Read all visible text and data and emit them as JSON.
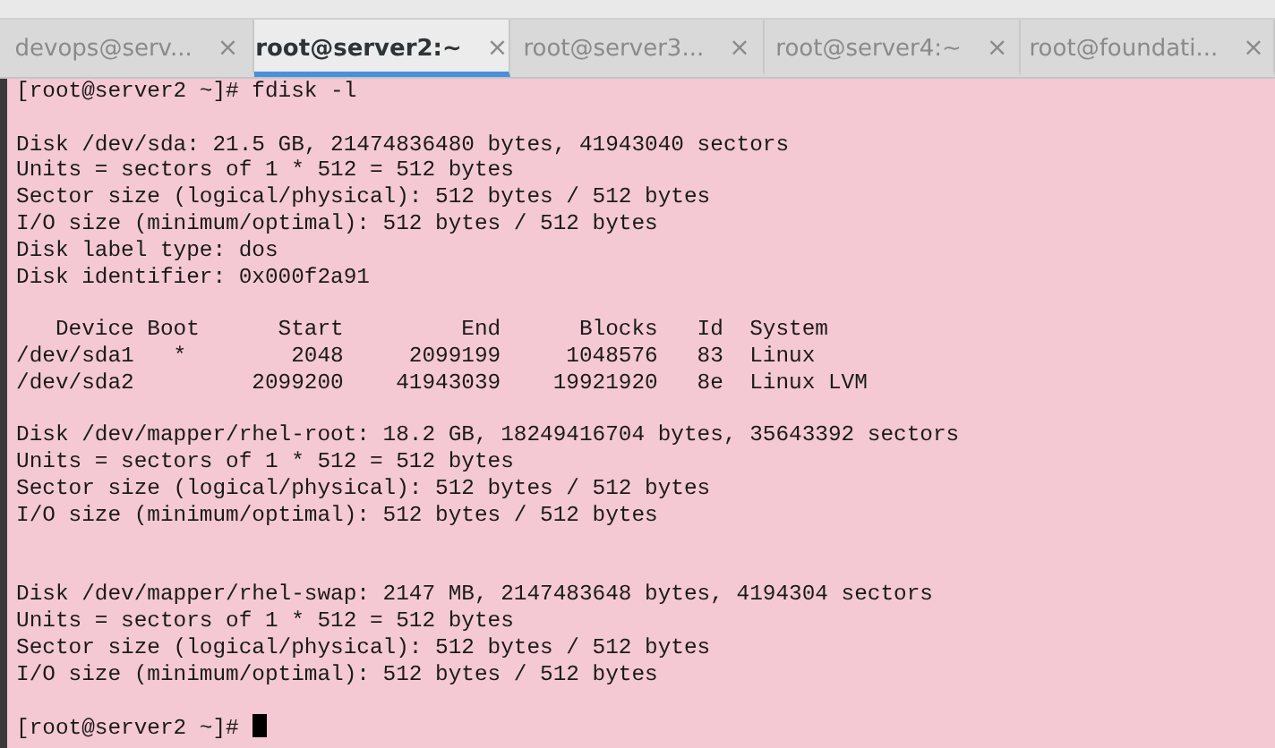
{
  "tabs": [
    {
      "label": "devops@serv...",
      "close": "×",
      "selected": false
    },
    {
      "label": "root@server2:~",
      "close": "×",
      "selected": true
    },
    {
      "label": "root@server3...",
      "close": "×",
      "selected": false
    },
    {
      "label": "root@server4:~",
      "close": "×",
      "selected": false
    },
    {
      "label": "root@foundati...",
      "close": "×",
      "selected": false
    }
  ],
  "terminal": {
    "lines": [
      {
        "kind": "text",
        "text": "[root@server2 ~]# fdisk -l"
      },
      {
        "kind": "blank"
      },
      {
        "kind": "text",
        "text": "Disk /dev/sda: 21.5 GB, 21474836480 bytes, 41943040 sectors"
      },
      {
        "kind": "text",
        "text": "Units = sectors of 1 * 512 = 512 bytes"
      },
      {
        "kind": "text",
        "text": "Sector size (logical/physical): 512 bytes / 512 bytes"
      },
      {
        "kind": "text",
        "text": "I/O size (minimum/optimal): 512 bytes / 512 bytes"
      },
      {
        "kind": "text",
        "text": "Disk label type: dos"
      },
      {
        "kind": "text",
        "text": "Disk identifier: 0x000f2a91"
      },
      {
        "kind": "blank"
      },
      {
        "kind": "text",
        "text": "   Device Boot      Start         End      Blocks   Id  System"
      },
      {
        "kind": "text",
        "text": "/dev/sda1   *        2048     2099199     1048576   83  Linux"
      },
      {
        "kind": "text",
        "text": "/dev/sda2         2099200    41943039    19921920   8e  Linux LVM"
      },
      {
        "kind": "blank"
      },
      {
        "kind": "text",
        "text": "Disk /dev/mapper/rhel-root: 18.2 GB, 18249416704 bytes, 35643392 sectors"
      },
      {
        "kind": "text",
        "text": "Units = sectors of 1 * 512 = 512 bytes"
      },
      {
        "kind": "text",
        "text": "Sector size (logical/physical): 512 bytes / 512 bytes"
      },
      {
        "kind": "text",
        "text": "I/O size (minimum/optimal): 512 bytes / 512 bytes"
      },
      {
        "kind": "blank"
      },
      {
        "kind": "blank"
      },
      {
        "kind": "text",
        "text": "Disk /dev/mapper/rhel-swap: 2147 MB, 2147483648 bytes, 4194304 sectors"
      },
      {
        "kind": "text",
        "text": "Units = sectors of 1 * 512 = 512 bytes"
      },
      {
        "kind": "text",
        "text": "Sector size (logical/physical): 512 bytes / 512 bytes"
      },
      {
        "kind": "text",
        "text": "I/O size (minimum/optimal): 512 bytes / 512 bytes"
      },
      {
        "kind": "blank"
      },
      {
        "kind": "prompt",
        "text": "[root@server2 ~]# "
      }
    ]
  }
}
